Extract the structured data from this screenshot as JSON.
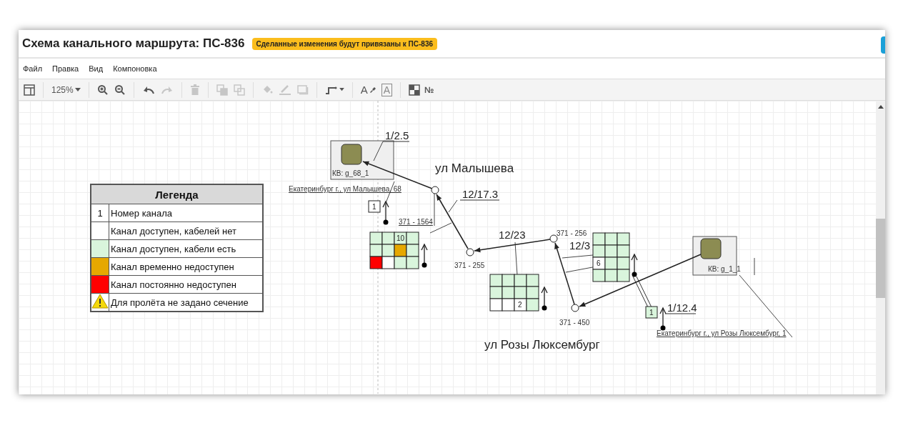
{
  "title": "Схема канального маршрута: ПС-836",
  "badge": "Сделанные изменения будут привязаны к ПС-836",
  "menu": [
    "Файл",
    "Правка",
    "Вид",
    "Компоновка"
  ],
  "tools": [
    {
      "kind": "layout",
      "disabled": false
    },
    {
      "kind": "zoom",
      "text": "125%",
      "disabled": false
    },
    {
      "kind": "zoom-in",
      "disabled": false
    },
    {
      "kind": "zoom-out",
      "disabled": false
    },
    {
      "kind": "undo",
      "disabled": false
    },
    {
      "kind": "redo",
      "disabled": true
    },
    {
      "kind": "delete",
      "disabled": true
    },
    {
      "kind": "to-front",
      "disabled": true
    },
    {
      "kind": "to-back",
      "disabled": true
    },
    {
      "kind": "fill",
      "disabled": true
    },
    {
      "kind": "line",
      "disabled": true
    },
    {
      "kind": "shadow",
      "disabled": true
    },
    {
      "kind": "connector",
      "disabled": false
    },
    {
      "kind": "font-color",
      "text": "A",
      "disabled": false
    },
    {
      "kind": "text-box",
      "text": "A",
      "disabled": true
    },
    {
      "kind": "numbering",
      "text": "№",
      "disabled": false
    }
  ],
  "legend": {
    "title": "Легенда",
    "rows": [
      {
        "kind": "number",
        "text": "1",
        "label": "Номер канала"
      },
      {
        "kind": "swatch",
        "color": "#ffffff",
        "label": "Канал доступен, кабелей нет"
      },
      {
        "kind": "swatch",
        "color": "#d9f5dc",
        "label": "Канал доступен, кабели есть"
      },
      {
        "kind": "swatch",
        "color": "#e6a800",
        "label": "Канал временно недоступен"
      },
      {
        "kind": "swatch",
        "color": "#ff0000",
        "label": "Канал постоянно недоступен"
      },
      {
        "kind": "warning",
        "label": "Для пролёта не задано сечение"
      }
    ]
  },
  "diagram": {
    "wells": [
      {
        "label": "КВ: g_68_1",
        "address": "Екатеринбург г., ул Малышева, 68"
      },
      {
        "label": "КВ: g_1_1",
        "address": "Екатеринбург г., ул Розы Люксембург, 1"
      }
    ],
    "nodes": [
      "371 - 1564",
      "371 - 255",
      "371 - 256",
      "371 - 450"
    ],
    "spans": [
      "1/2.5",
      "12/17.3",
      "12/23",
      "12/3",
      "1/12.4"
    ],
    "streets": [
      "ул Малышева",
      "ул Розы Люксембург"
    ],
    "markers": [
      {
        "text": "1",
        "color": "#ffffff"
      },
      {
        "text": "1",
        "color": "#d9f5dc"
      }
    ],
    "blocks": [
      {
        "rows": [
          [
            {
              "color": "#d9f5dc"
            },
            {
              "color": "#d9f5dc"
            },
            {
              "color": "#d9f5dc",
              "text": "10"
            },
            {
              "color": "#d9f5dc"
            }
          ],
          [
            {
              "color": "#d9f5dc"
            },
            {
              "color": "#d9f5dc"
            },
            {
              "color": "#e6a800"
            },
            {
              "color": "#d9f5dc"
            }
          ],
          [
            {
              "color": "#ff0000"
            },
            {
              "color": "#ffffff"
            },
            {
              "color": "#d9f5dc"
            },
            {
              "color": "#d9f5dc"
            }
          ]
        ]
      },
      {
        "rows": [
          [
            {
              "color": "#d9f5dc"
            },
            {
              "color": "#d9f5dc"
            },
            {
              "color": "#d9f5dc"
            },
            {
              "color": "#d9f5dc"
            }
          ],
          [
            {
              "color": "#d9f5dc"
            },
            {
              "color": "#d9f5dc"
            },
            {
              "color": "#d9f5dc"
            },
            {
              "color": "#d9f5dc"
            }
          ],
          [
            {
              "color": "#ffffff"
            },
            {
              "color": "#ffffff"
            },
            {
              "color": "#ffffff",
              "text": "2"
            },
            {
              "color": "#d9f5dc"
            }
          ]
        ]
      },
      {
        "rows": [
          [
            {
              "color": "#d9f5dc"
            },
            {
              "color": "#d9f5dc"
            },
            {
              "color": "#d9f5dc"
            }
          ],
          [
            {
              "color": "#d9f5dc"
            },
            {
              "color": "#d9f5dc"
            },
            {
              "color": "#d9f5dc"
            }
          ],
          [
            {
              "color": "#ffffff",
              "text": "6"
            },
            {
              "color": "#d9f5dc"
            },
            {
              "color": "#d9f5dc"
            }
          ],
          [
            {
              "color": "#d9f5dc"
            },
            {
              "color": "#d9f5dc"
            },
            {
              "color": "#d9f5dc"
            }
          ]
        ]
      }
    ]
  }
}
